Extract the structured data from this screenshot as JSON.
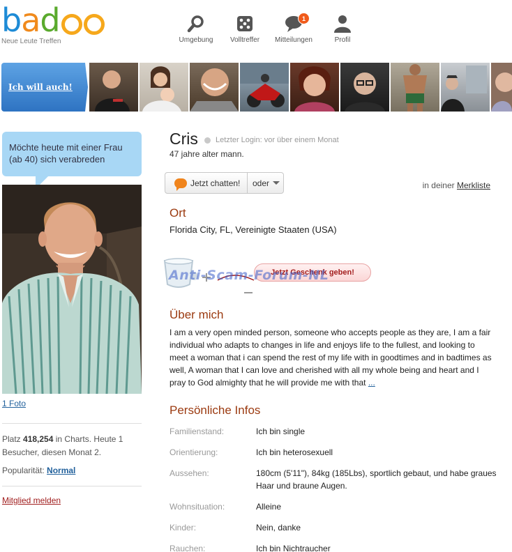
{
  "brand": {
    "logo_text": "badoo",
    "tagline": "Neue Leute Treffen",
    "colors": {
      "b": "#1e8bd6",
      "a": "#f08a1c",
      "d": "#5aaa2d",
      "o": "#f6a81c"
    }
  },
  "nav": {
    "items": [
      {
        "label": "Umgebung",
        "icon": "search-icon"
      },
      {
        "label": "Volltreffer",
        "icon": "dice-icon"
      },
      {
        "label": "Mitteilungen",
        "icon": "chat-bubble-icon",
        "badge": "1"
      },
      {
        "label": "Profil",
        "icon": "person-icon"
      }
    ]
  },
  "strip": {
    "button_label": "Ich will auch!"
  },
  "sidebar": {
    "intent": "Möchte heute mit einer Frau (ab 40) sich verabreden",
    "photo_count_link": "1 Foto",
    "stats_prefix": "Platz ",
    "stats_rank": "418,254",
    "stats_suffix": " in Charts. Heute 1 Besucher, diesen Monat 2.",
    "popularity_label": "Popularität: ",
    "popularity_value": "Normal",
    "report_link": "Mitglied melden"
  },
  "profile": {
    "name": "Cris",
    "last_login": "Letzter Login: vor über einem Monat",
    "subline": "47 jahre alter mann.",
    "chat_button": "Jetzt chatten!",
    "or_button": "oder",
    "watchlist_prefix": "in deiner ",
    "watchlist_link": "Merkliste",
    "location_heading": "Ort",
    "location_value": "Florida City, FL, Vereinigte Staaten (USA)",
    "gift_button": "Jetzt Geschenk geben!",
    "watermark": "Anti-Scam-Forum-NL",
    "about_heading": "Über mich",
    "about_text": "I am a very open minded person, someone who accepts people as they are, I am a fair individual who adapts to changes in life and enjoys life to the fullest, and looking to meet a woman that i can spend the rest of my life with in goodtimes and in badtimes as well, A woman that I can love and cherished with all my whole being and heart and I pray to God almighty that he will provide me with that ",
    "about_more": "...",
    "info_heading": "Persönliche Infos",
    "info": [
      {
        "key": "Familienstand:",
        "value": "Ich bin single"
      },
      {
        "key": "Orientierung:",
        "value": "Ich bin heterosexuell"
      },
      {
        "key": "Aussehen:",
        "value": "180cm (5'11\"), 84kg (185Lbs), sportlich gebaut, und habe graues Haar und braune Augen."
      },
      {
        "key": "Wohnsituation:",
        "value": "Alleine"
      },
      {
        "key": "Kinder:",
        "value": "Nein, danke"
      },
      {
        "key": "Rauchen:",
        "value": "Ich bin Nichtraucher"
      }
    ]
  }
}
